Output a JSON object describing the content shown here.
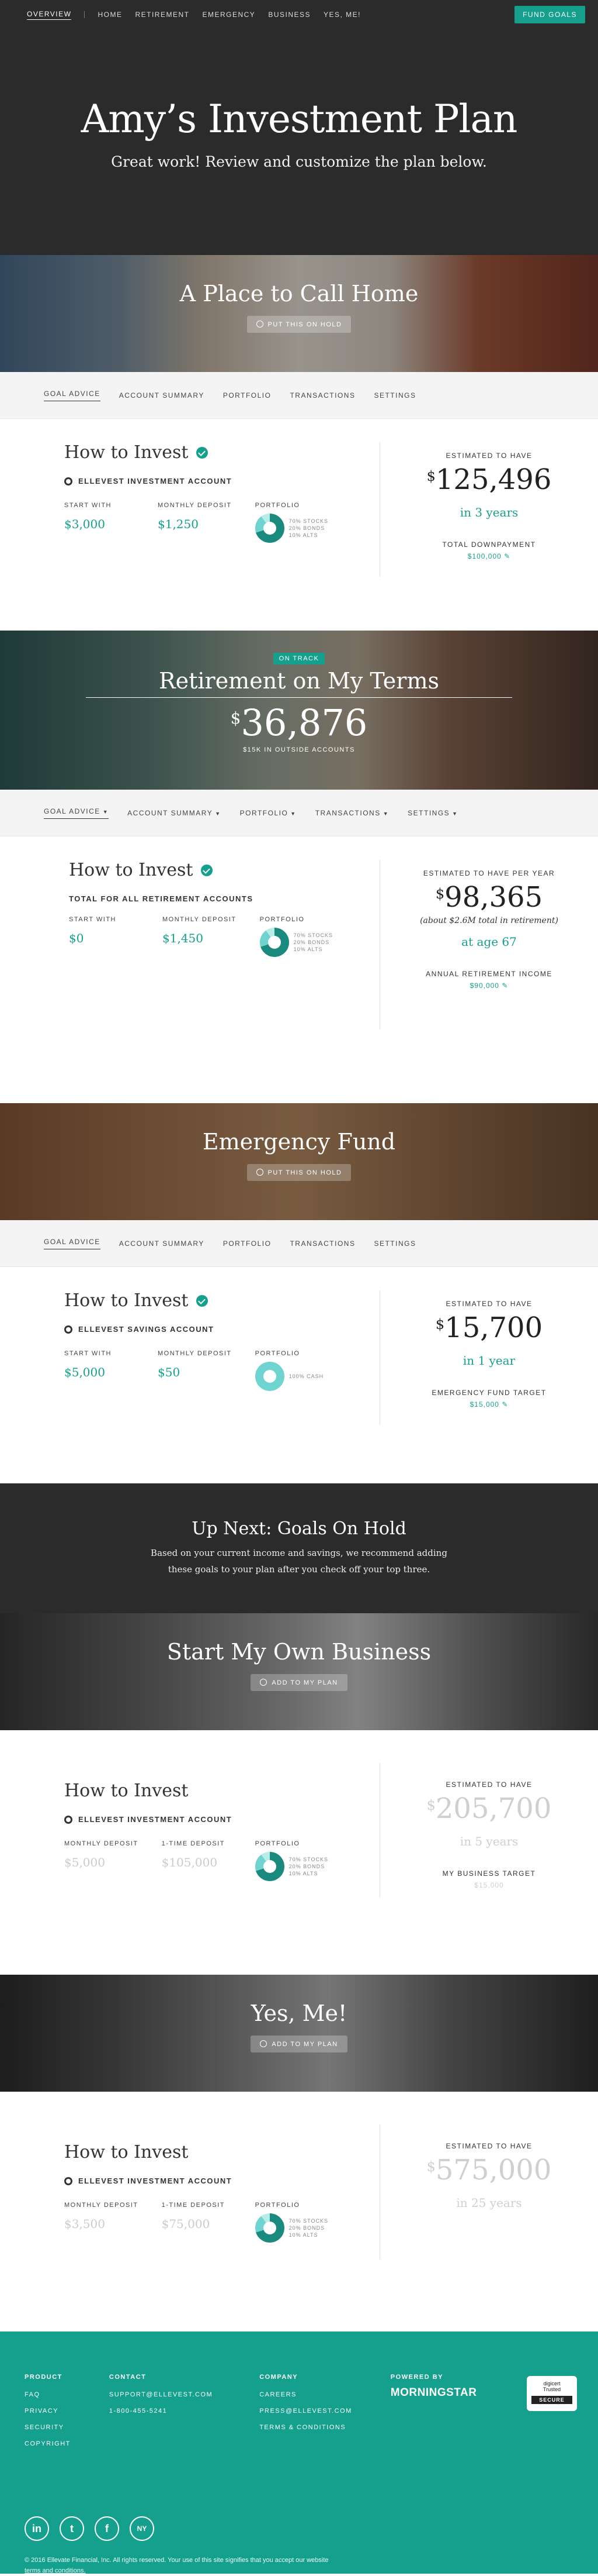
{
  "topnav": {
    "items": [
      "OVERVIEW",
      "HOME",
      "RETIREMENT",
      "EMERGENCY",
      "BUSINESS",
      "YES, ME!"
    ],
    "fund_button": "FUND GOALS"
  },
  "hero": {
    "title": "Amy’s Investment Plan",
    "subtitle": "Great work! Review and customize the plan below."
  },
  "goals": [
    {
      "banner_title": "A Place to Call Home",
      "banner_button": "PUT THIS ON HOLD",
      "tabs": [
        "GOAL ADVICE",
        "ACCOUNT SUMMARY",
        "PORTFOLIO",
        "TRANSACTIONS",
        "SETTINGS"
      ],
      "how_title": "How to Invest",
      "account": "ELLEVEST INVESTMENT ACCOUNT",
      "fields": [
        {
          "label": "START WITH",
          "value": "$3,000"
        },
        {
          "label": "MONTHLY DEPOSIT",
          "value": "$1,250"
        }
      ],
      "portfolio_label": "PORTFOLIO",
      "allocation": [
        "70% STOCKS",
        "20% BONDS",
        "10% ALTS"
      ],
      "est_label": "ESTIMATED TO HAVE",
      "est_amount": "125,496",
      "est_years": "in 3 years",
      "target_label": "TOTAL DOWNPAYMENT",
      "target_value": "$100,000"
    },
    {
      "badge": "ON TRACK",
      "banner_title": "Retirement on My Terms",
      "banner_amount": "36,876",
      "banner_sub": "$15K IN OUTSIDE ACCOUNTS",
      "tabs": [
        "GOAL ADVICE",
        "ACCOUNT SUMMARY",
        "PORTFOLIO",
        "TRANSACTIONS",
        "SETTINGS"
      ],
      "how_title": "How to Invest",
      "account": "TOTAL FOR ALL RETIREMENT ACCOUNTS",
      "fields": [
        {
          "label": "START WITH",
          "value": "$0"
        },
        {
          "label": "MONTHLY DEPOSIT",
          "value": "$1,450"
        }
      ],
      "portfolio_label": "PORTFOLIO",
      "allocation": [
        "70% STOCKS",
        "20% BONDS",
        "10% ALTS"
      ],
      "est_label": "ESTIMATED TO HAVE PER YEAR",
      "est_amount": "98,365",
      "est_sub": "(about $2.6M total in retirement)",
      "est_years": "at age 67",
      "target_label": "ANNUAL RETIREMENT INCOME",
      "target_value": "$90,000"
    },
    {
      "banner_title": "Emergency Fund",
      "banner_button": "PUT THIS ON HOLD",
      "tabs": [
        "GOAL ADVICE",
        "ACCOUNT SUMMARY",
        "PORTFOLIO",
        "TRANSACTIONS",
        "SETTINGS"
      ],
      "how_title": "How to Invest",
      "account": "ELLEVEST SAVINGS ACCOUNT",
      "fields": [
        {
          "label": "START WITH",
          "value": "$5,000"
        },
        {
          "label": "MONTHLY DEPOSIT",
          "value": "$50"
        }
      ],
      "portfolio_label": "PORTFOLIO",
      "allocation": [
        "100% CASH"
      ],
      "est_label": "ESTIMATED TO HAVE",
      "est_amount": "15,700",
      "est_years": "in 1 year",
      "target_label": "EMERGENCY FUND TARGET",
      "target_value": "$15,000"
    }
  ],
  "upnext": {
    "title": "Up Next: Goals On Hold",
    "line1": "Based on your current income and savings, we recommend adding",
    "line2": "these goals to your plan after you check off your top three."
  },
  "held_goals": [
    {
      "banner_title": "Start My Own Business",
      "banner_button": "ADD TO MY PLAN",
      "how_title": "How to Invest",
      "account": "ELLEVEST INVESTMENT ACCOUNT",
      "fields": [
        {
          "label": "MONTHLY DEPOSIT",
          "value": "$5,000"
        },
        {
          "label": "1-TIME DEPOSIT",
          "value": "$105,000"
        }
      ],
      "portfolio_label": "PORTFOLIO",
      "allocation": [
        "70% STOCKS",
        "20% BONDS",
        "10% ALTS"
      ],
      "est_label": "ESTIMATED TO HAVE",
      "est_amount": "205,700",
      "est_years": "in 5 years",
      "target_label": "MY BUSINESS TARGET",
      "target_value": "$15,000"
    },
    {
      "banner_title": "Yes, Me!",
      "banner_button": "ADD TO MY PLAN",
      "how_title": "How to Invest",
      "account": "ELLEVEST INVESTMENT ACCOUNT",
      "fields": [
        {
          "label": "MONTHLY DEPOSIT",
          "value": "$3,500"
        },
        {
          "label": "1-TIME DEPOSIT",
          "value": "$75,000"
        }
      ],
      "portfolio_label": "PORTFOLIO",
      "allocation": [
        "70% STOCKS",
        "20% BONDS",
        "10% ALTS"
      ],
      "est_label": "ESTIMATED TO HAVE",
      "est_amount": "575,000",
      "est_years": "in 25 years"
    }
  ],
  "footer": {
    "product": {
      "head": "PRODUCT",
      "items": [
        "FAQ",
        "PRIVACY",
        "SECURITY",
        "COPYRIGHT"
      ]
    },
    "contact": {
      "head": "CONTACT",
      "items": [
        "SUPPORT@ELLEVEST.COM",
        "1-800-455-5241"
      ]
    },
    "company": {
      "head": "COMPANY",
      "items": [
        "CAREERS",
        "PRESS@ELLEVEST.COM",
        "TERMS & CONDITIONS"
      ]
    },
    "powered": {
      "head": "POWERED BY",
      "brand": "MORNINGSTAR"
    },
    "digicert": {
      "line1": "digicert",
      "line2": "Trusted",
      "secure": "SECURE"
    },
    "legal": "© 2016 Ellevate Financial, Inc. All rights reserved. Your use of this site signifies that you accept our website",
    "legal_link": "terms and conditions."
  },
  "colors": {
    "accent": "#15a08d",
    "dark": "#2b2b2b"
  }
}
